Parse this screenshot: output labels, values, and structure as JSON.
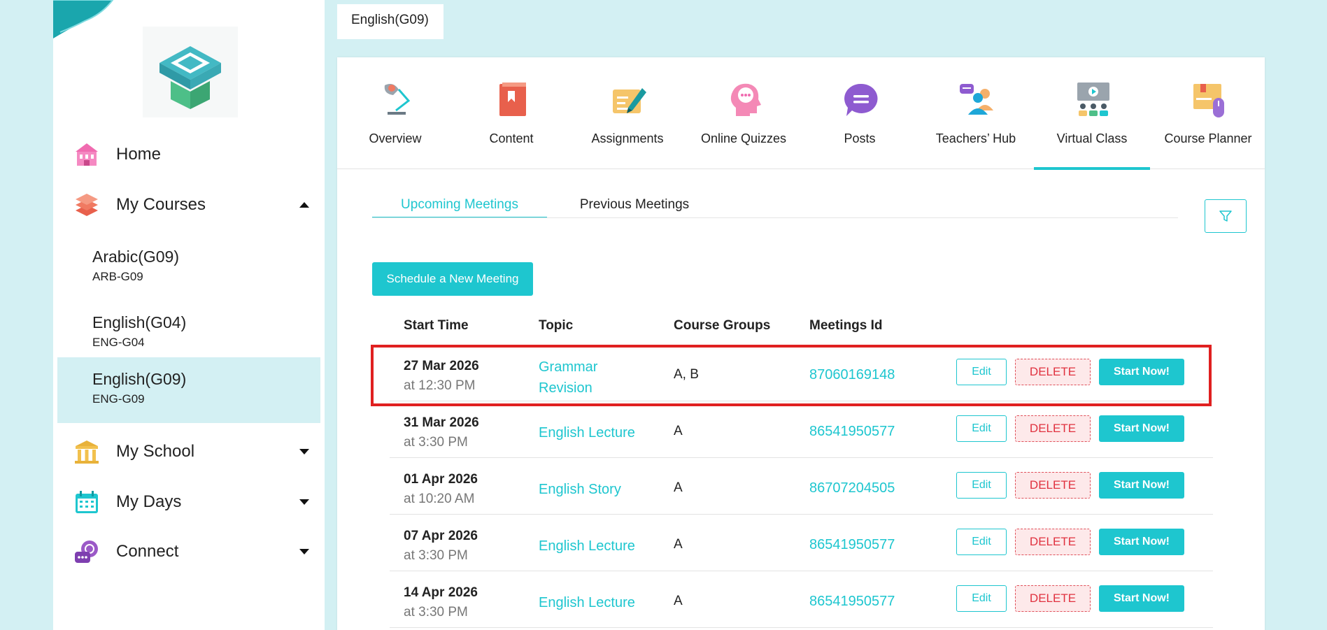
{
  "sidebar": {
    "home_label": "Home",
    "my_courses_label": "My Courses",
    "courses": [
      {
        "name": "Arabic(G09)",
        "code": "ARB-G09"
      },
      {
        "name": "English(G04)",
        "code": "ENG-G04"
      },
      {
        "name": "English(G09)",
        "code": "ENG-G09"
      }
    ],
    "my_school_label": "My School",
    "my_days_label": "My Days",
    "connect_label": "Connect"
  },
  "breadcrumb": {
    "title": "English(G09)"
  },
  "modules": [
    {
      "label": "Overview"
    },
    {
      "label": "Content"
    },
    {
      "label": "Assignments"
    },
    {
      "label": "Online Quizzes"
    },
    {
      "label": "Posts"
    },
    {
      "label": "Teachers’ Hub"
    },
    {
      "label": "Virtual Class"
    },
    {
      "label": "Course Planner"
    }
  ],
  "meetings": {
    "tab_upcoming": "Upcoming Meetings",
    "tab_previous": "Previous Meetings",
    "schedule_button": "Schedule a New Meeting",
    "headers": {
      "start_time": "Start Time",
      "topic": "Topic",
      "course_groups": "Course Groups",
      "meetings_id": "Meetings Id"
    },
    "buttons": {
      "edit": "Edit",
      "delete": "DELETE",
      "start": "Start Now!"
    },
    "rows": [
      {
        "date": "27 Mar 2026",
        "time": "at 12:30 PM",
        "topic": "Grammar Revision",
        "groups": "A, B",
        "meeting_id": "87060169148"
      },
      {
        "date": "31 Mar 2026",
        "time": "at 3:30 PM",
        "topic": "English Lecture",
        "groups": "A",
        "meeting_id": "86541950577"
      },
      {
        "date": "01 Apr 2026",
        "time": "at 10:20 AM",
        "topic": "English Story",
        "groups": "A",
        "meeting_id": "86707204505"
      },
      {
        "date": "07 Apr 2026",
        "time": "at 3:30 PM",
        "topic": "English Lecture",
        "groups": "A",
        "meeting_id": "86541950577"
      },
      {
        "date": "14 Apr 2026",
        "time": "at 3:30 PM",
        "topic": "English Lecture",
        "groups": "A",
        "meeting_id": "86541950577"
      }
    ]
  },
  "colors": {
    "accent": "#1ec6cf",
    "background": "#d3f0f3",
    "delete": "#e0313f",
    "highlight": "#e02020"
  }
}
